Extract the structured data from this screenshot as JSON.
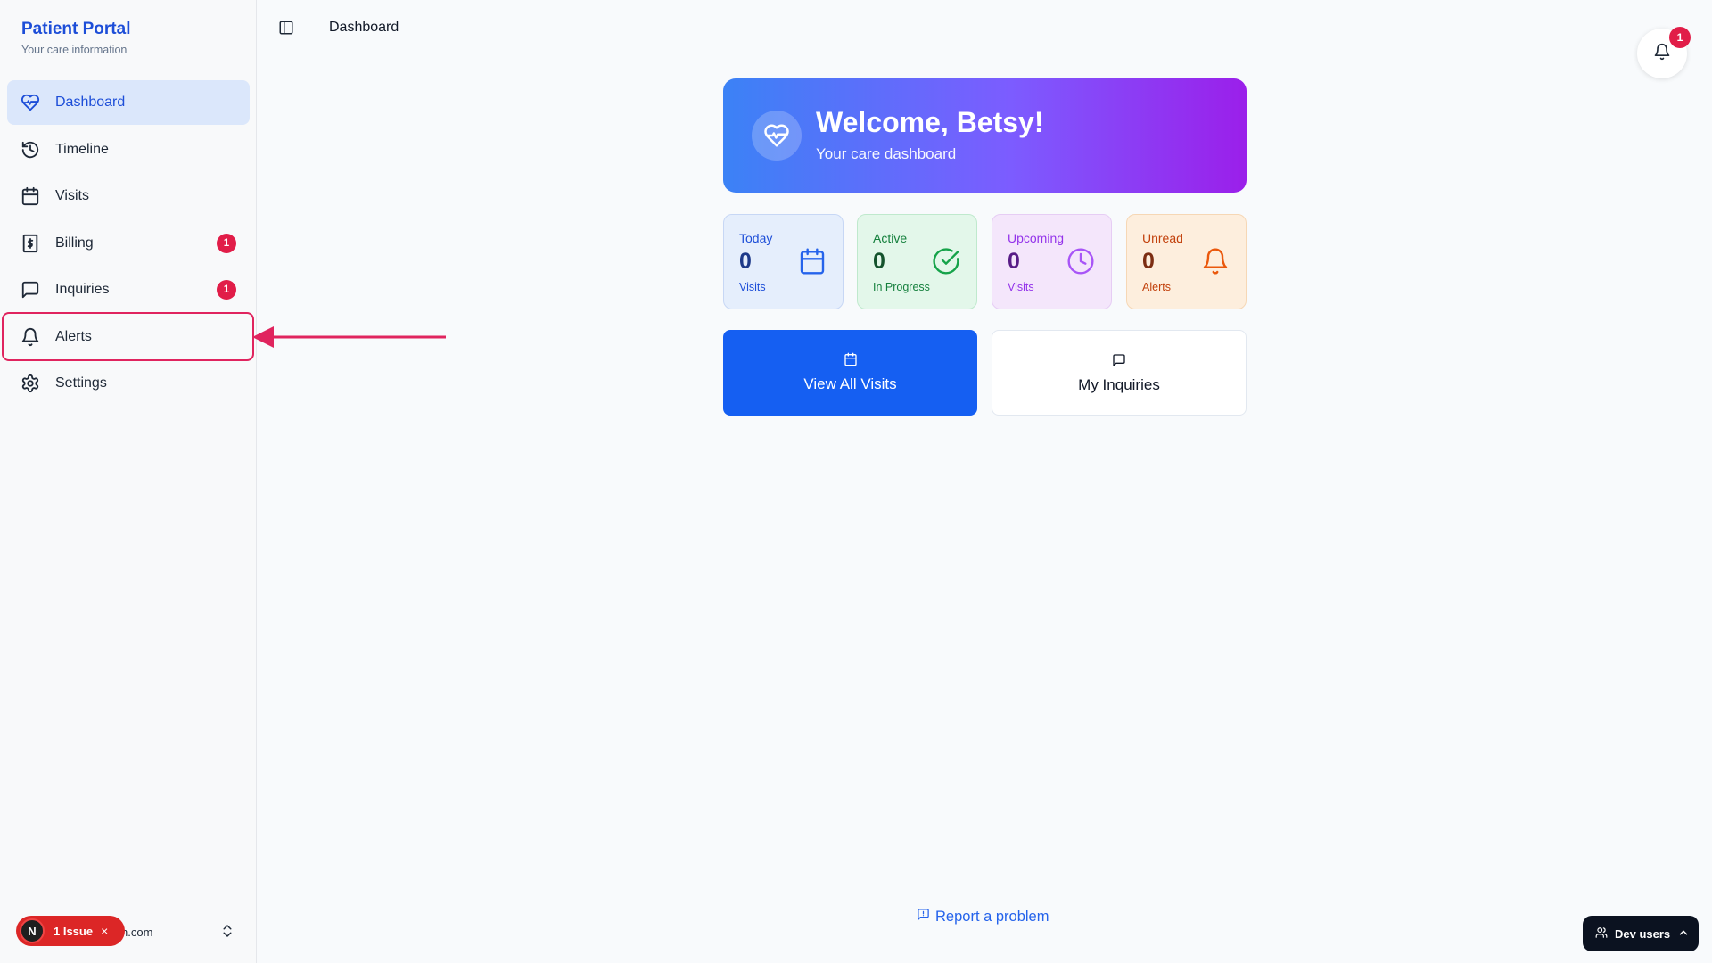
{
  "brand": {
    "title": "Patient Portal",
    "subtitle": "Your care information"
  },
  "sidebar": {
    "items": [
      {
        "label": "Dashboard",
        "icon": "heart-pulse-icon",
        "active": true
      },
      {
        "label": "Timeline",
        "icon": "history-icon"
      },
      {
        "label": "Visits",
        "icon": "calendar-icon"
      },
      {
        "label": "Billing",
        "icon": "receipt-dollar-icon",
        "badge": "1"
      },
      {
        "label": "Inquiries",
        "icon": "message-square-icon",
        "badge": "1"
      },
      {
        "label": "Alerts",
        "icon": "bell-icon",
        "highlighted": true
      },
      {
        "label": "Settings",
        "icon": "gear-icon"
      }
    ],
    "footer": {
      "issue_letter": "N",
      "issue_label": "1 Issue",
      "issue_close": "×",
      "email_fragment": "n.com"
    }
  },
  "topbar": {
    "breadcrumb": "Dashboard",
    "notification_count": "1"
  },
  "welcome": {
    "title": "Welcome, Betsy!",
    "subtitle": "Your care dashboard"
  },
  "stats": [
    {
      "label": "Today",
      "value": "0",
      "sub": "Visits",
      "color": "#1d4ed8"
    },
    {
      "label": "Active",
      "value": "0",
      "sub": "In Progress",
      "color": "#15803d"
    },
    {
      "label": "Upcoming",
      "value": "0",
      "sub": "Visits",
      "color": "#9333ea"
    },
    {
      "label": "Unread",
      "value": "0",
      "sub": "Alerts",
      "color": "#c2410c"
    }
  ],
  "actions": {
    "visits_label": "View All Visits",
    "inquiries_label": "My Inquiries"
  },
  "report_label": "Report a problem",
  "dev_users_label": "Dev users",
  "colors": {
    "accent": "#155ff2",
    "badge": "#e11d48",
    "highlight": "#e0245e"
  }
}
